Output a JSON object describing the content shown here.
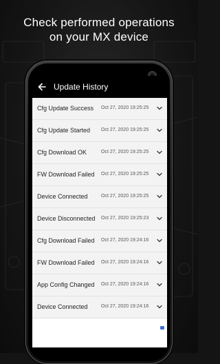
{
  "headline": {
    "line1": "Check performed operations",
    "line2": "on your MX device"
  },
  "app": {
    "title": "Update History",
    "back_icon": "arrow-back-icon"
  },
  "history": [
    {
      "label": "Cfg Update Success",
      "time": "Oct 27, 2020 19:25:25"
    },
    {
      "label": "Cfg Update Started",
      "time": "Oct 27, 2020 19:25:25"
    },
    {
      "label": "Cfg Download OK",
      "time": "Oct 27, 2020 19:25:25"
    },
    {
      "label": "FW Download Failed",
      "time": "Oct 27, 2020 19:25:25"
    },
    {
      "label": "Device Connected",
      "time": "Oct 27, 2020 19:25:25"
    },
    {
      "label": "Device Disconnected",
      "time": "Oct 27, 2020 19:25:23"
    },
    {
      "label": "Cfg Download Failed",
      "time": "Oct 27, 2020 19:24:16"
    },
    {
      "label": "FW Download Failed",
      "time": "Oct 27, 2020 19:24:16"
    },
    {
      "label": "App Config Changed",
      "time": "Oct 27, 2020 19:24:16"
    },
    {
      "label": "Device Connected",
      "time": "Oct 27, 2020 19:24:16"
    }
  ],
  "colors": {
    "background": "#141414",
    "appbar": "#000000",
    "row": "#f3f3f3",
    "accent": "#3b6fd6"
  }
}
